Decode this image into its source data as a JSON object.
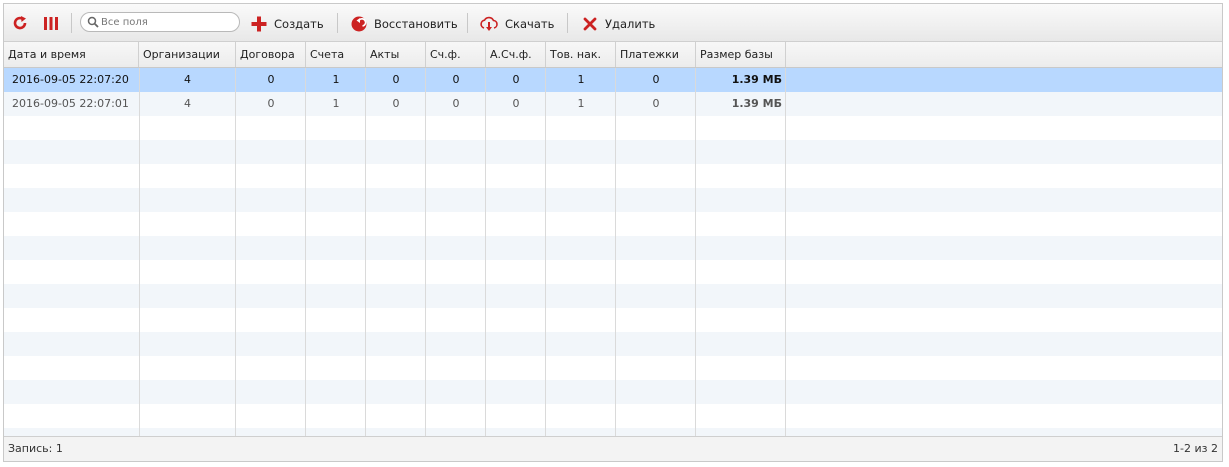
{
  "toolbar": {
    "search": {
      "placeholder": "Все поля",
      "value": ""
    },
    "buttons": {
      "create": "Создать",
      "restore": "Восстановить",
      "download": "Скачать",
      "delete": "Удалить"
    }
  },
  "colors": {
    "accent_red": "#cc2222",
    "selected_row": "#b8d8ff",
    "stripe": "#f2f6fa"
  },
  "icons": [
    "refresh-icon",
    "columns-icon",
    "search-icon",
    "plus-icon",
    "restore-icon",
    "download-cloud-icon",
    "delete-x-icon"
  ],
  "table": {
    "columns": [
      "Дата и время",
      "Организации",
      "Договора",
      "Счета",
      "Акты",
      "Сч.ф.",
      "А.Сч.ф.",
      "Тов. нак.",
      "Платежки",
      "Размер базы"
    ],
    "rows": [
      [
        "2016-09-05 22:07:20",
        "4",
        "0",
        "1",
        "0",
        "0",
        "0",
        "1",
        "0",
        "1.39 МБ"
      ],
      [
        "2016-09-05 22:07:01",
        "4",
        "0",
        "1",
        "0",
        "0",
        "0",
        "1",
        "0",
        "1.39 МБ"
      ]
    ],
    "selected_row": 0
  },
  "footer": {
    "record": "Запись: 1",
    "range": "1-2 из 2"
  }
}
